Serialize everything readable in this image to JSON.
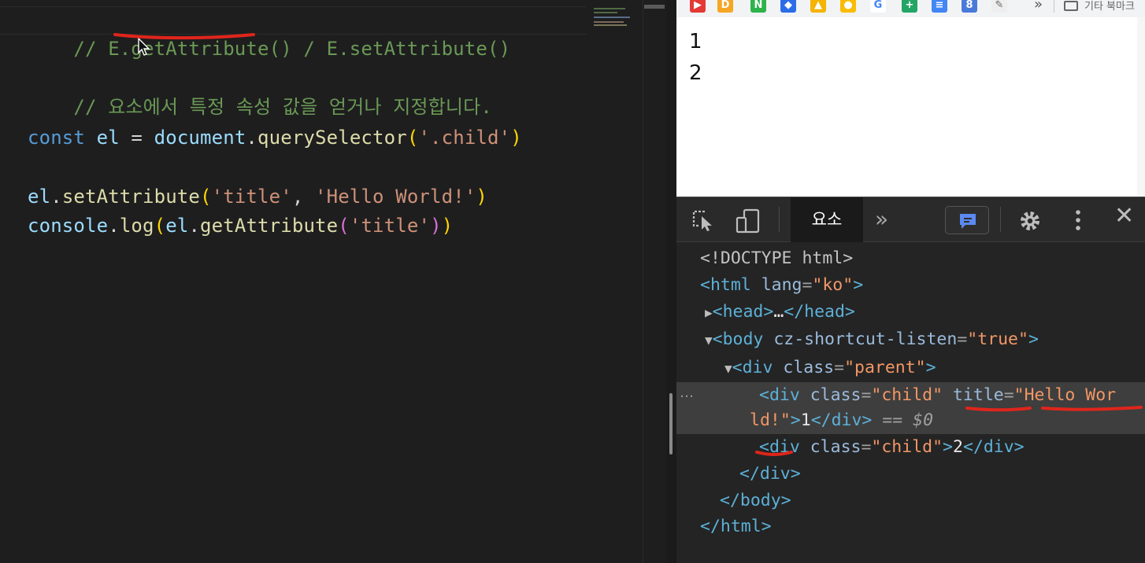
{
  "editor": {
    "line1": {
      "comment": "// E.getAttribute() / E.setAttribute()"
    },
    "line2": {
      "comment": "// 요소에서 특정 속성 값을 얻거나 지정합니다."
    },
    "line3": {
      "kw": "const",
      "var": "el",
      "eq": " = ",
      "obj": "document",
      "dot": ".",
      "fn": "querySelector",
      "open": "(",
      "arg": "'.child'",
      "close": ")"
    },
    "line4": {
      "obj": "el",
      "dot": ".",
      "fn": "setAttribute",
      "open": "(",
      "arg1": "'title'",
      "comma": ", ",
      "arg2": "'Hello World!'",
      "close": ")"
    },
    "line5": {
      "obj": "console",
      "dot": ".",
      "fn": "log",
      "open": "(",
      "inner_obj": "el",
      "inner_dot": ".",
      "inner_fn": "getAttribute",
      "inner_open": "(",
      "arg": "'title'",
      "inner_close": ")",
      "close": ")"
    }
  },
  "browser": {
    "bookmarks_more": "»",
    "other_bookmarks": "기타 북마크",
    "viewport_lines": [
      "1",
      "2"
    ]
  },
  "devtools": {
    "tab_elements": "요소",
    "tab_more": "»",
    "close": "✕",
    "selected_dots": "…",
    "dom": {
      "doctype": "<!DOCTYPE html>",
      "html_open": "<html",
      "html_attr": "lang",
      "html_val": "\"ko\"",
      "html_close": ">",
      "head": "<head>",
      "head_ellipsis": "…",
      "head_end": "</head>",
      "body_open": "<body",
      "body_attr": "cz-shortcut-listen",
      "body_val": "\"true\"",
      "body_close": ">",
      "div_parent_open": "<div",
      "div_parent_attr": "class",
      "div_parent_val": "\"parent\"",
      "div_parent_close": ">",
      "child1_open": "<div",
      "child1_class_attr": "class",
      "child1_class_val": "\"child\"",
      "child1_title_attr": "title",
      "child1_title_val_a": "\"Hello Wor",
      "child1_title_val_b": "ld!\"",
      "child1_gt": ">",
      "child1_text": "1",
      "child1_end": "</div>",
      "child1_eq": " == ",
      "child1_sel": "$0",
      "child2_open": "<div",
      "child2_class_attr": "class",
      "child2_class_val": "\"child\"",
      "child2_gt": ">",
      "child2_text": "2",
      "child2_end": "</div>",
      "div_end": "</div>",
      "body_end": "</body>",
      "html_end": "</html>"
    }
  },
  "colors": {
    "annotation": "#e0251b",
    "comment": "#6a9955",
    "keyword": "#569cd6",
    "string": "#ce9178",
    "function": "#dcdcaa"
  }
}
